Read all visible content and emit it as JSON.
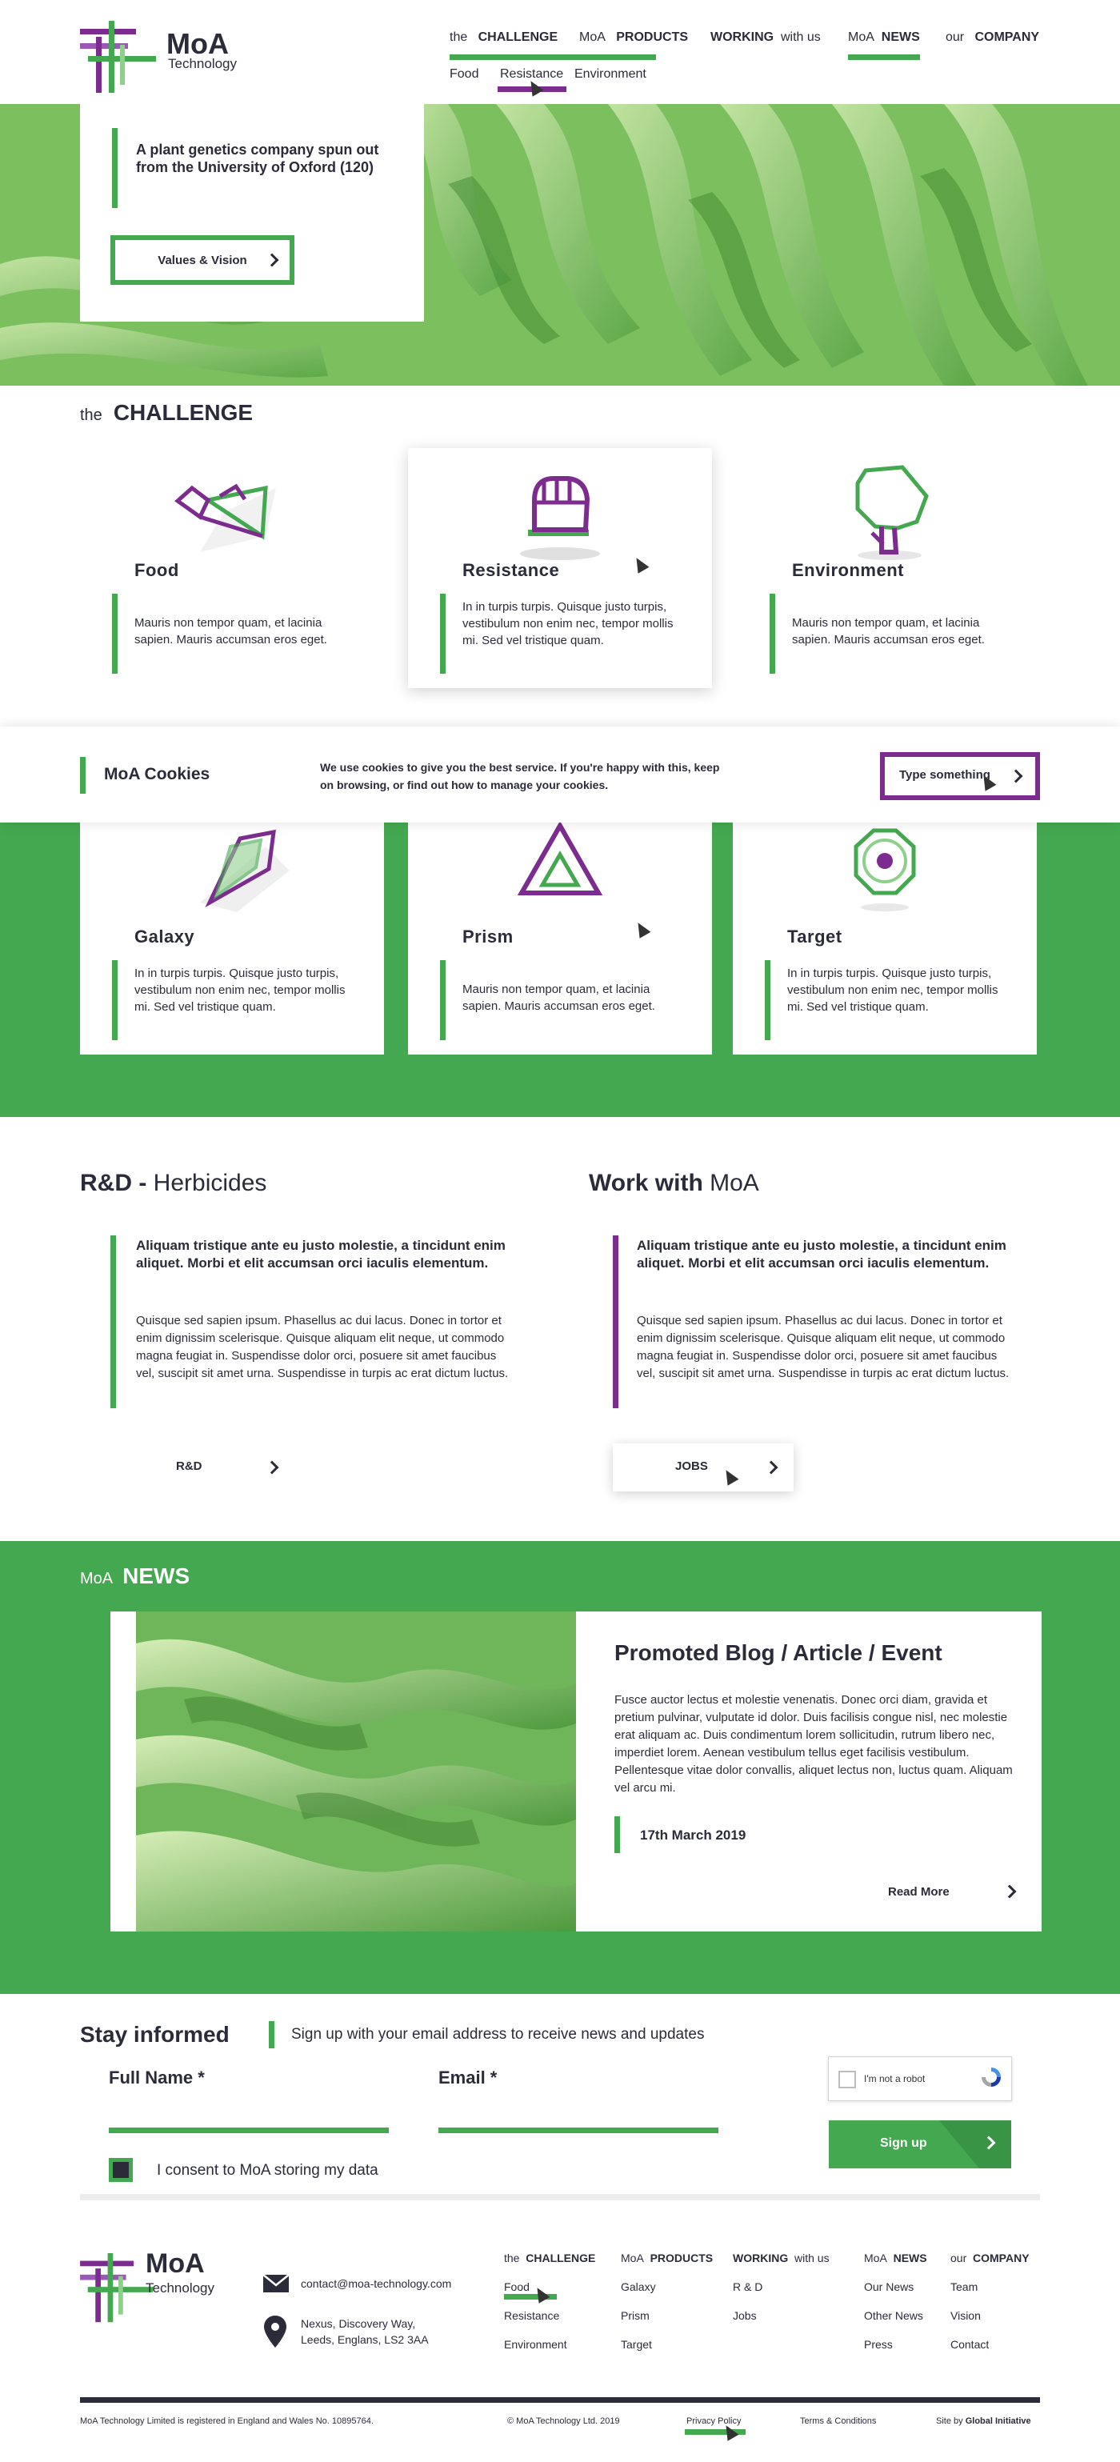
{
  "brand": {
    "name": "MoA",
    "sub": "Technology",
    "green": "#43a84f",
    "purple": "#7b2c8e",
    "ink": "#2b2b3a"
  },
  "nav": {
    "challenge_pre": "the",
    "challenge": "CHALLENGE",
    "products_pre": "MoA",
    "products": "PRODUCTS",
    "working": "WORKING",
    "working_post": "with us",
    "news_pre": "MoA",
    "news": "NEWS",
    "company_pre": "our",
    "company": "COMPANY",
    "sub_items": [
      "Food",
      "Resistance",
      "Environment"
    ]
  },
  "hero": {
    "text": "A plant genetics company spun out from the University of Oxford (120)",
    "button": "Values & Vision"
  },
  "challenge": {
    "title_pre": "the",
    "title": "CHALLENGE",
    "cards": [
      {
        "title": "Food",
        "text": "Mauris non tempor quam, et lacinia sapien. Mauris accumsan eros eget.",
        "icon": "kite-plant-icon"
      },
      {
        "title": "Resistance",
        "text": "In in turpis turpis. Quisque justo turpis, vestibulum non enim nec, tempor mollis mi. Sed vel tristique quam.",
        "icon": "fist-icon"
      },
      {
        "title": "Environment",
        "text": "Mauris non tempor quam, et lacinia sapien. Mauris accumsan eros eget.",
        "icon": "tree-icon"
      }
    ]
  },
  "cookies": {
    "title": "MoA Cookies",
    "text": "We use cookies to give you the best service. If you're happy with this, keep on browsing, or find out how to manage your cookies.",
    "button": "Type something"
  },
  "products": {
    "cards": [
      {
        "title": "Galaxy",
        "text": "In in turpis turpis. Quisque justo turpis, vestibulum non enim nec, tempor mollis mi. Sed vel tristique quam.",
        "icon": "galaxy-gem-icon"
      },
      {
        "title": "Prism",
        "text": "Mauris non tempor quam, et lacinia sapien. Mauris accumsan eros eget.",
        "icon": "prism-triangle-icon"
      },
      {
        "title": "Target",
        "text": "In in turpis turpis. Quisque justo turpis, vestibulum non enim nec, tempor mollis mi. Sed vel tristique quam.",
        "icon": "target-octagon-icon"
      }
    ]
  },
  "rd": {
    "title_bold": "R&D -",
    "title_rest": "Herbicides",
    "lead": "Aliquam tristique ante eu justo molestie, a tincidunt enim aliquet. Morbi et elit accumsan orci iaculis elementum.",
    "body": "Quisque sed sapien ipsum. Phasellus ac dui lacus. Donec in tortor et enim dignissim scelerisque. Quisque aliquam elit neque, ut commodo magna feugiat in. Suspendisse dolor orci, posuere sit amet faucibus vel, suscipit sit amet urna. Suspendisse in turpis ac erat dictum luctus.",
    "link": "R&D"
  },
  "work": {
    "title_bold": "Work with",
    "title_rest": "MoA",
    "lead": "Aliquam tristique ante eu justo molestie, a tincidunt enim aliquet. Morbi et elit accumsan orci iaculis elementum.",
    "body": "Quisque sed sapien ipsum. Phasellus ac dui lacus. Donec in tortor et enim dignissim scelerisque. Quisque aliquam elit neque, ut commodo magna feugiat in. Suspendisse dolor orci, posuere sit amet faucibus vel, suscipit sit amet urna. Suspendisse in turpis ac erat dictum luctus.",
    "link": "JOBS"
  },
  "news": {
    "title_pre": "MoA",
    "title": "NEWS",
    "headline": "Promoted Blog / Article / Event",
    "body": "Fusce auctor lectus et molestie venenatis. Donec orci diam, gravida et pretium pulvinar, vulputate id dolor. Duis facilisis congue nisl, nec molestie erat aliquam ac. Duis condimentum lorem sollicitudin, rutrum libero nec, imperdiet lorem. Aenean vestibulum tellus eget facilisis vestibulum. Pellentesque vitae dolor convallis, aliquet lectus non, luctus quam. Aliquam vel arcu mi.",
    "date": "17th March 2019",
    "more": "Read More"
  },
  "signup": {
    "title": "Stay informed",
    "sub": "Sign up with your email address to receive news and updates",
    "name_label": "Full Name *",
    "email_label": "Email *",
    "name_value": "",
    "email_value": "",
    "captcha": "I'm not a robot",
    "button": "Sign up",
    "consent": "I consent to MoA storing my data"
  },
  "footer": {
    "email": "contact@moa-technology.com",
    "address_1": "Nexus, Discovery Way,",
    "address_2": "Leeds, Englans, LS2 3AA",
    "cols": [
      {
        "pre": "the",
        "head": "CHALLENGE",
        "links": [
          "Food",
          "Resistance",
          "Environment"
        ]
      },
      {
        "pre": "MoA",
        "head": "PRODUCTS",
        "links": [
          "Galaxy",
          "Prism",
          "Target"
        ]
      },
      {
        "pre": "WORKING",
        "head": "with us",
        "links": [
          "R & D",
          "Jobs"
        ]
      },
      {
        "pre": "MoA",
        "head": "NEWS",
        "links": [
          "Our News",
          "Other News",
          "Press"
        ]
      },
      {
        "pre": "our",
        "head": "COMPANY",
        "links": [
          "Team",
          "Vision",
          "Contact"
        ]
      }
    ],
    "registered": "MoA Technology Limited is registered in England and Wales No. 10895764.",
    "copyright": "© MoA Technology Ltd. 2019",
    "privacy": "Privacy Policy",
    "terms": "Terms & Conditions",
    "site_by_pre": "Site by",
    "site_by": "Global Initiative"
  }
}
